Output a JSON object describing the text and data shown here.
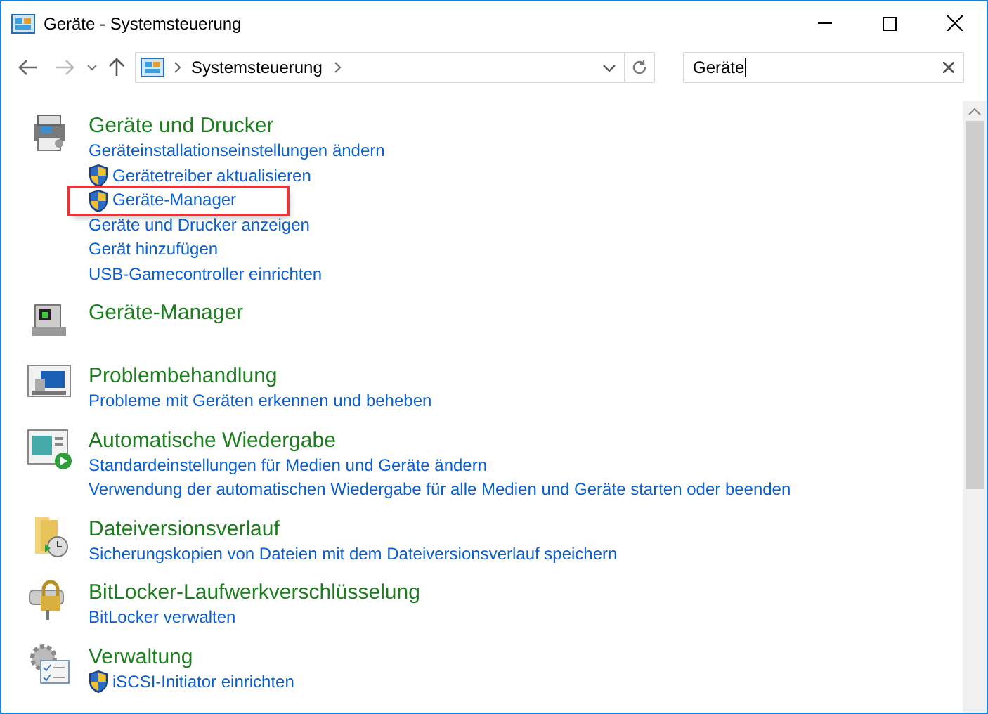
{
  "window": {
    "title": "Geräte - Systemsteuerung"
  },
  "address_bar": {
    "path": [
      "Systemsteuerung"
    ]
  },
  "search": {
    "value": "Geräte"
  },
  "results": [
    {
      "title": "Geräte und Drucker",
      "links": [
        {
          "label": "Geräteinstallationseinstellungen ändern",
          "shield": false,
          "highlighted": false
        },
        {
          "label": "Gerätetreiber aktualisieren",
          "shield": true,
          "highlighted": false
        },
        {
          "label": "Geräte-Manager",
          "shield": true,
          "highlighted": true
        },
        {
          "label": "Geräte und Drucker anzeigen",
          "shield": false,
          "highlighted": false
        },
        {
          "label": "Gerät hinzufügen",
          "shield": false,
          "highlighted": false
        },
        {
          "label": "USB-Gamecontroller einrichten",
          "shield": false,
          "highlighted": false
        }
      ]
    },
    {
      "title": "Geräte-Manager"
    },
    {
      "title": "Problembehandlung",
      "links": [
        {
          "label": "Probleme mit Geräten erkennen und beheben",
          "shield": false,
          "highlighted": false
        }
      ]
    },
    {
      "title": "Automatische Wiedergabe",
      "links": [
        {
          "label": "Standardeinstellungen für Medien und Geräte ändern",
          "shield": false,
          "highlighted": false
        },
        {
          "label": "Verwendung der automatischen Wiedergabe für alle Medien und Geräte starten oder beenden",
          "shield": false,
          "highlighted": false
        }
      ]
    },
    {
      "title": "Dateiversionsverlauf",
      "links": [
        {
          "label": "Sicherungskopien von Dateien mit dem Dateiversionsverlauf speichern",
          "shield": false,
          "highlighted": false
        }
      ]
    },
    {
      "title": "BitLocker-Laufwerkverschlüsselung",
      "links": [
        {
          "label": "BitLocker verwalten",
          "shield": false,
          "highlighted": false
        }
      ]
    },
    {
      "title": "Verwaltung",
      "links": [
        {
          "label": "iSCSI-Initiator einrichten",
          "shield": true,
          "highlighted": false
        }
      ]
    }
  ]
}
